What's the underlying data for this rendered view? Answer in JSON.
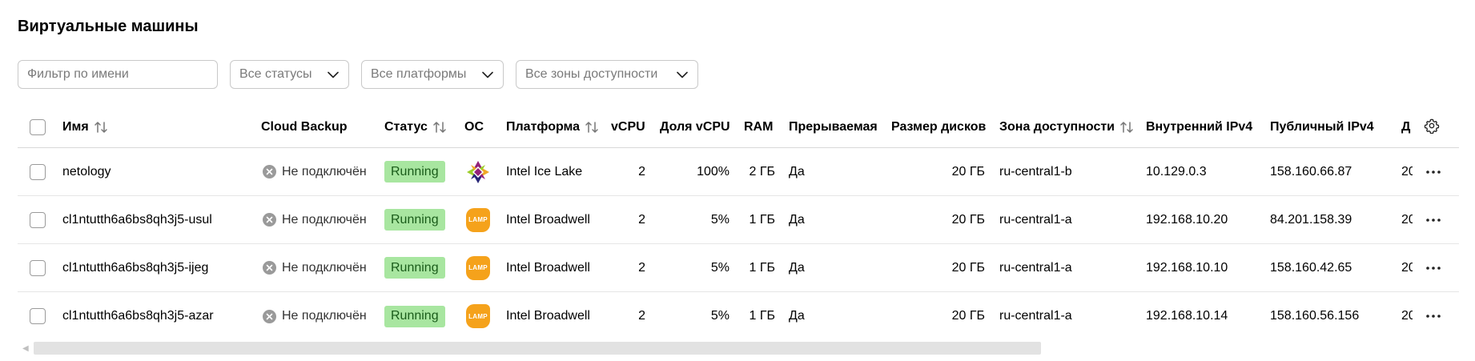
{
  "page": {
    "title": "Виртуальные машины"
  },
  "filters": {
    "name_placeholder": "Фильтр по имени",
    "status": "Все статусы",
    "platform": "Все платформы",
    "zone": "Все зоны доступности"
  },
  "columns": {
    "name": "Имя",
    "backup": "Cloud Backup",
    "status": "Статус",
    "os": "ОС",
    "platform": "Платформа",
    "vcpu": "vCPU",
    "vcpu_share": "Доля vCPU",
    "ram": "RAM",
    "preemptible": "Прерываемая",
    "disk_size": "Размер дисков",
    "zone": "Зона доступности",
    "internal_ip": "Внутренний IPv4",
    "public_ip": "Публичный IPv4",
    "next": "Д"
  },
  "rows": [
    {
      "name": "netology",
      "backup": "Не подключён",
      "status": "Running",
      "os": "centos-icon",
      "platform": "Intel Ice Lake",
      "vcpu": "2",
      "vcpu_share": "100%",
      "ram": "2 ГБ",
      "preemptible": "Да",
      "disk": "20 ГБ",
      "zone": "ru-central1-b",
      "internal_ip": "10.129.0.3",
      "public_ip": "158.160.66.87",
      "next": "20"
    },
    {
      "name": "cl1ntutth6a6bs8qh3j5-usul",
      "backup": "Не подключён",
      "status": "Running",
      "os": "lamp-icon",
      "platform": "Intel Broadwell",
      "vcpu": "2",
      "vcpu_share": "5%",
      "ram": "1 ГБ",
      "preemptible": "Да",
      "disk": "20 ГБ",
      "zone": "ru-central1-a",
      "internal_ip": "192.168.10.20",
      "public_ip": "84.201.158.39",
      "next": "20"
    },
    {
      "name": "cl1ntutth6a6bs8qh3j5-ijeg",
      "backup": "Не подключён",
      "status": "Running",
      "os": "lamp-icon",
      "platform": "Intel Broadwell",
      "vcpu": "2",
      "vcpu_share": "5%",
      "ram": "1 ГБ",
      "preemptible": "Да",
      "disk": "20 ГБ",
      "zone": "ru-central1-a",
      "internal_ip": "192.168.10.10",
      "public_ip": "158.160.42.65",
      "next": "20"
    },
    {
      "name": "cl1ntutth6a6bs8qh3j5-azar",
      "backup": "Не подключён",
      "status": "Running",
      "os": "lamp-icon",
      "platform": "Intel Broadwell",
      "vcpu": "2",
      "vcpu_share": "5%",
      "ram": "1 ГБ",
      "preemptible": "Да",
      "disk": "20 ГБ",
      "zone": "ru-central1-a",
      "internal_ip": "192.168.10.14",
      "public_ip": "158.160.56.156",
      "next": "20"
    }
  ],
  "os_labels": {
    "lamp": "LAMP"
  },
  "colors": {
    "running_bg": "#a8e6a0",
    "running_fg": "#1a5c1a",
    "lamp": "#f5a21b"
  }
}
